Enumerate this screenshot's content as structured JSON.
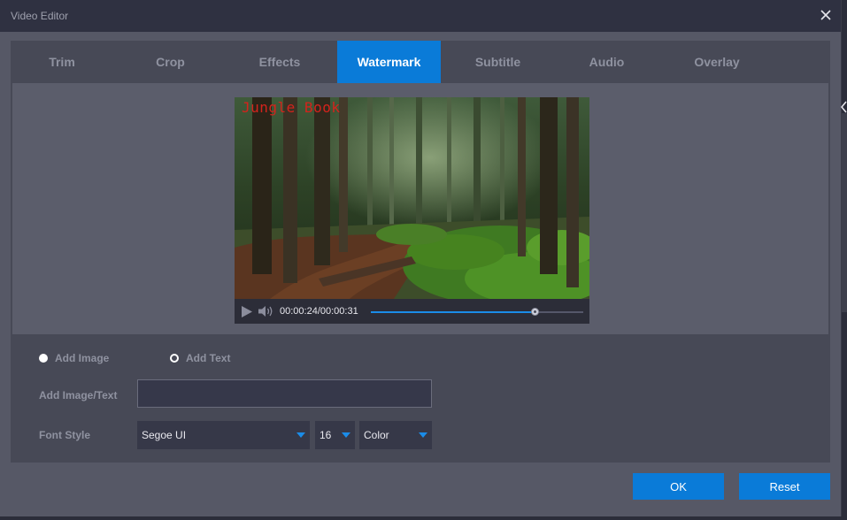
{
  "window": {
    "title": "Video Editor"
  },
  "tabs": [
    {
      "label": "Trim",
      "active": false
    },
    {
      "label": "Crop",
      "active": false
    },
    {
      "label": "Effects",
      "active": false
    },
    {
      "label": "Watermark",
      "active": true
    },
    {
      "label": "Subtitle",
      "active": false
    },
    {
      "label": "Audio",
      "active": false
    },
    {
      "label": "Overlay",
      "active": false
    }
  ],
  "preview": {
    "watermark_text": "Jungle Book",
    "time_display": "00:00:24/00:00:31",
    "progress_fraction": 0.77
  },
  "watermark": {
    "option_image": "Add Image",
    "option_text": "Add Text",
    "image_text_label": "Add Image/Text",
    "image_text_value": "",
    "font_style_label": "Font Style",
    "font_name": "Segoe UI",
    "font_size": "16",
    "color_label": "Color"
  },
  "buttons": {
    "ok": "OK",
    "reset": "Reset"
  },
  "colors": {
    "accent": "#0a7bd8",
    "watermark_color": "#d4231c",
    "seek_fill": "#1b8ce8"
  },
  "icons": {
    "close": "close-icon",
    "play": "play-icon",
    "volume": "volume-icon",
    "dropdown": "chevron-down-icon"
  }
}
